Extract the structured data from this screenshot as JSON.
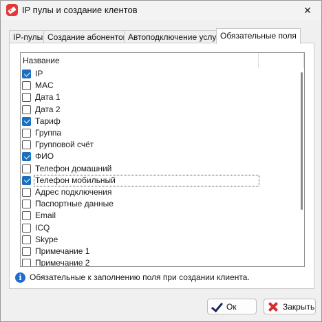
{
  "window": {
    "title": "IP пулы и создание клентов",
    "close_symbol": "✕"
  },
  "tabs": [
    {
      "label": "IP-пулы",
      "active": false
    },
    {
      "label": "Создание абонентов",
      "active": false
    },
    {
      "label": "Автоподключение услуг",
      "active": false
    },
    {
      "label": "Обязательные поля",
      "active": true
    }
  ],
  "list": {
    "column_header": "Название",
    "items": [
      {
        "label": "IP",
        "checked": true
      },
      {
        "label": "MAC",
        "checked": false
      },
      {
        "label": "Дата 1",
        "checked": false
      },
      {
        "label": "Дата 2",
        "checked": false
      },
      {
        "label": "Тариф",
        "checked": true
      },
      {
        "label": "Группа",
        "checked": false
      },
      {
        "label": "Групповой счёт",
        "checked": false
      },
      {
        "label": "ФИО",
        "checked": true
      },
      {
        "label": "Телефон домашний",
        "checked": false
      },
      {
        "label": "Телефон мобильный",
        "checked": true
      },
      {
        "label": "Адрес подключения",
        "checked": false
      },
      {
        "label": "Паспортные данные",
        "checked": false
      },
      {
        "label": "Email",
        "checked": false
      },
      {
        "label": "ICQ",
        "checked": false
      },
      {
        "label": "Skype",
        "checked": false
      },
      {
        "label": "Примечание 1",
        "checked": false
      },
      {
        "label": "Примечание 2",
        "checked": false
      }
    ]
  },
  "info": {
    "text": "Обязательные к заполнению поля при создании клиента."
  },
  "buttons": {
    "ok": "Ок",
    "close": "Закрыть"
  },
  "colors": {
    "accent": "#1a6fc0",
    "app_icon": "#e53935",
    "close_icon": "#d32f2f",
    "info_icon": "#1f6cd1"
  },
  "icons": {
    "app": "app-logo-icon",
    "info": "info-icon",
    "ok": "checkmark-icon",
    "close": "red-x-icon"
  }
}
